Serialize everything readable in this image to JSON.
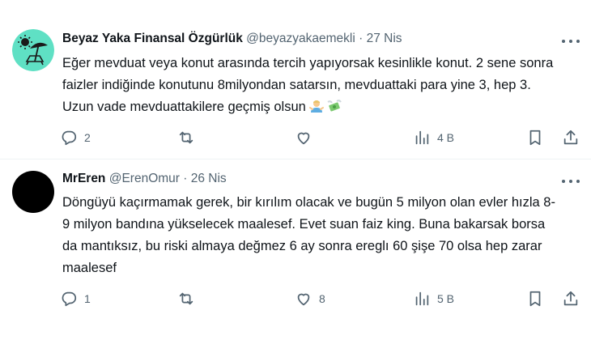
{
  "tweets": [
    {
      "author": "Beyaz Yaka Finansal Özgürlük",
      "handle": "@beyazyakaemekli",
      "sep": "·",
      "date": "27 Nis",
      "text": "Eğer mevduat veya konut arasında tercih yapıyorsak kesinlikle konut. 2 sene sonra faizler indiğinde konutunu 8milyondan satarsın, mevduattaki para yine 3, hep 3. Uzun vade mevduattakilere geçmiş olsun",
      "emojis": [
        "man-shrugging-emoji",
        "money-with-wings-emoji"
      ],
      "replies": "2",
      "retweets": "",
      "likes": "",
      "views": "4 B",
      "avatar_color": "#5fe0c4"
    },
    {
      "author": "MrEren",
      "handle": "@ErenOmur",
      "sep": "·",
      "date": "26 Nis",
      "text": "Döngüyü kaçırmamak gerek, bir kırılım olacak ve bugün 5 milyon olan evler hızla 8-9 milyon bandına yükselecek maalesef. Evet suan faiz king. Buna bakarsak borsa da mantıksız, bu riski almaya değmez 6 ay sonra ereglı 60 şişe 70 olsa  hep zarar maalesef",
      "replies": "1",
      "retweets": "",
      "likes": "8",
      "views": "5 B",
      "avatar_color": "#000000"
    }
  ]
}
